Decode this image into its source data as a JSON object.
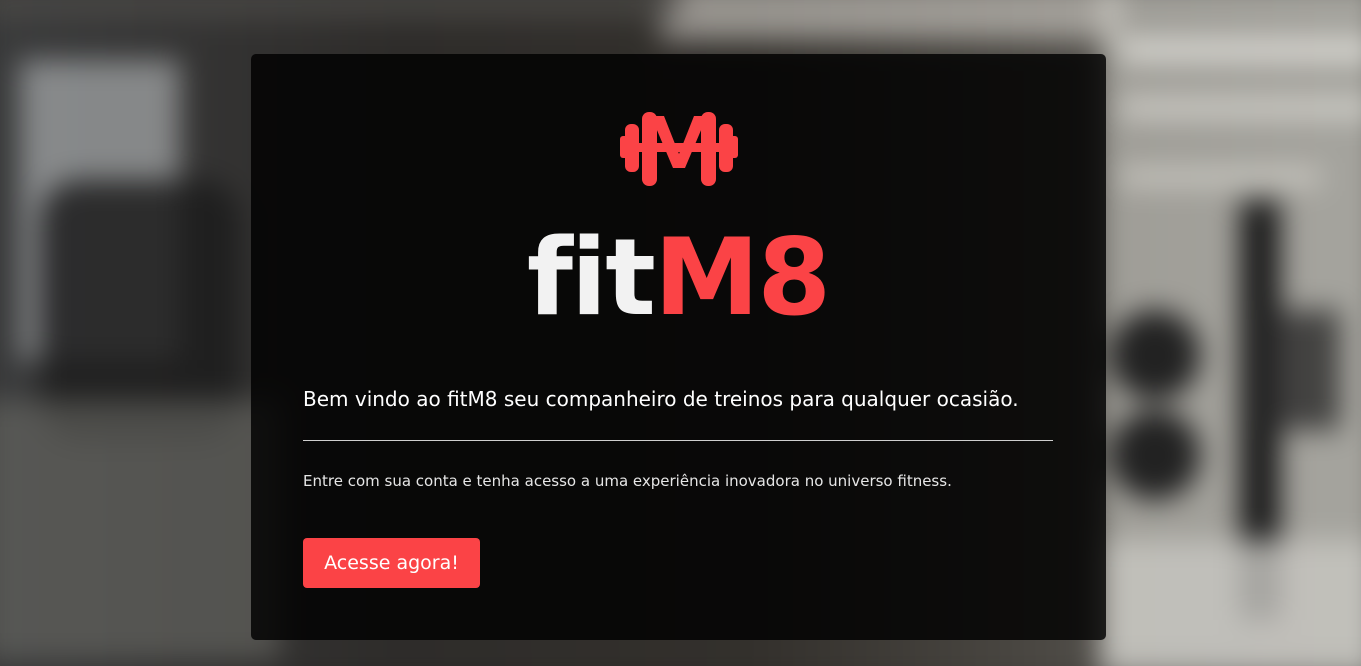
{
  "brand": {
    "name_part1": "fit",
    "name_part2": "M8",
    "accent_color": "#fb4346",
    "logo_icon": "dumbbell-m-icon"
  },
  "hero": {
    "headline": "Bem vindo ao fitM8 seu companheiro de treinos para qualquer ocasião.",
    "subtext": "Entre com sua conta e tenha acesso a uma experiência inovadora no universo fitness.",
    "cta_label": "Acesse agora!"
  },
  "background": {
    "image": "blurred-gym-photo"
  }
}
